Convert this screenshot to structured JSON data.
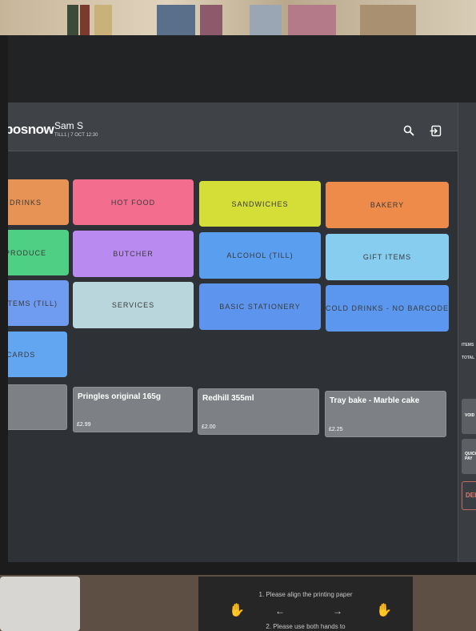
{
  "app": {
    "logo": "posnow",
    "user_name": "Sam S",
    "till_info": "TILL1 | 7 OCT 12:30"
  },
  "header_icons": [
    "search-icon",
    "logout-icon"
  ],
  "categories": [
    {
      "label": "DRINKS",
      "color": "#e79356"
    },
    {
      "label": "HOT FOOD",
      "color": "#f26d8e"
    },
    {
      "label": "SANDWICHES",
      "color": "#d4de36"
    },
    {
      "label": "BAKERY",
      "color": "#ee8a4a"
    },
    {
      "label": "PRODUCE",
      "color": "#4fcf84"
    },
    {
      "label": "BUTCHER",
      "color": "#b98af0"
    },
    {
      "label": "ALCOHOL (TILL)",
      "color": "#5a9ef0"
    },
    {
      "label": "GIFT ITEMS",
      "color": "#87cdf0"
    },
    {
      "label": "ITEMS (TILL)",
      "color": "#6f9cf0"
    },
    {
      "label": "SERVICES",
      "color": "#b8d6dc"
    },
    {
      "label": "BASIC STATIONERY",
      "color": "#5d95ee"
    },
    {
      "label": "COLD DRINKS - NO BARCODE",
      "color": "#5b97ee"
    },
    {
      "label": "GIFT CARDS",
      "color": "#62a6f2"
    }
  ],
  "products": [
    {
      "name": "",
      "price": ""
    },
    {
      "name": "Pringles original 165g",
      "price": "£2.99"
    },
    {
      "name": "Redhill 355ml",
      "price": "£2.00"
    },
    {
      "name": "Tray bake - Marble cake",
      "price": "£2.25"
    }
  ],
  "basket_panel": {
    "items_label": "ITEMS",
    "total_label": "TOTAL",
    "void_label": "VOID",
    "quick_pay_label": "QUICK PAY",
    "delete_label": "DEL"
  },
  "printer_instructions": {
    "line1": "1. Please align the printing paper",
    "line2": "2. Please use both hands to"
  }
}
